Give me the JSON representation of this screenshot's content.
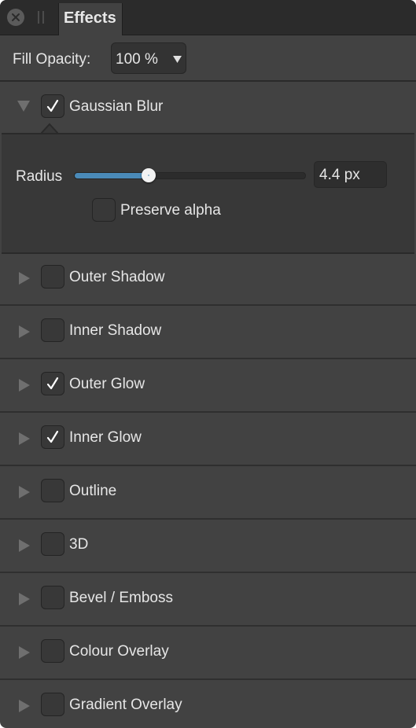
{
  "window": {
    "tab_label": "Effects"
  },
  "fill_opacity": {
    "label": "Fill Opacity:",
    "value": "100 %"
  },
  "gaussian_blur": {
    "label": "Gaussian Blur",
    "checked": true,
    "expanded": true,
    "radius_label": "Radius",
    "radius_value": "4.4 px",
    "radius_slider_fraction": 0.32,
    "preserve_alpha_label": "Preserve alpha",
    "preserve_alpha_checked": false
  },
  "effects": [
    {
      "label": "Outer Shadow",
      "checked": false
    },
    {
      "label": "Inner Shadow",
      "checked": false
    },
    {
      "label": "Outer Glow",
      "checked": true
    },
    {
      "label": "Inner Glow",
      "checked": true
    },
    {
      "label": "Outline",
      "checked": false
    },
    {
      "label": "3D",
      "checked": false
    },
    {
      "label": "Bevel / Emboss",
      "checked": false
    },
    {
      "label": "Colour Overlay",
      "checked": false
    },
    {
      "label": "Gradient Overlay",
      "checked": false
    }
  ],
  "colors": {
    "accent": "#4a8ab8",
    "panel_bg": "#424242"
  }
}
